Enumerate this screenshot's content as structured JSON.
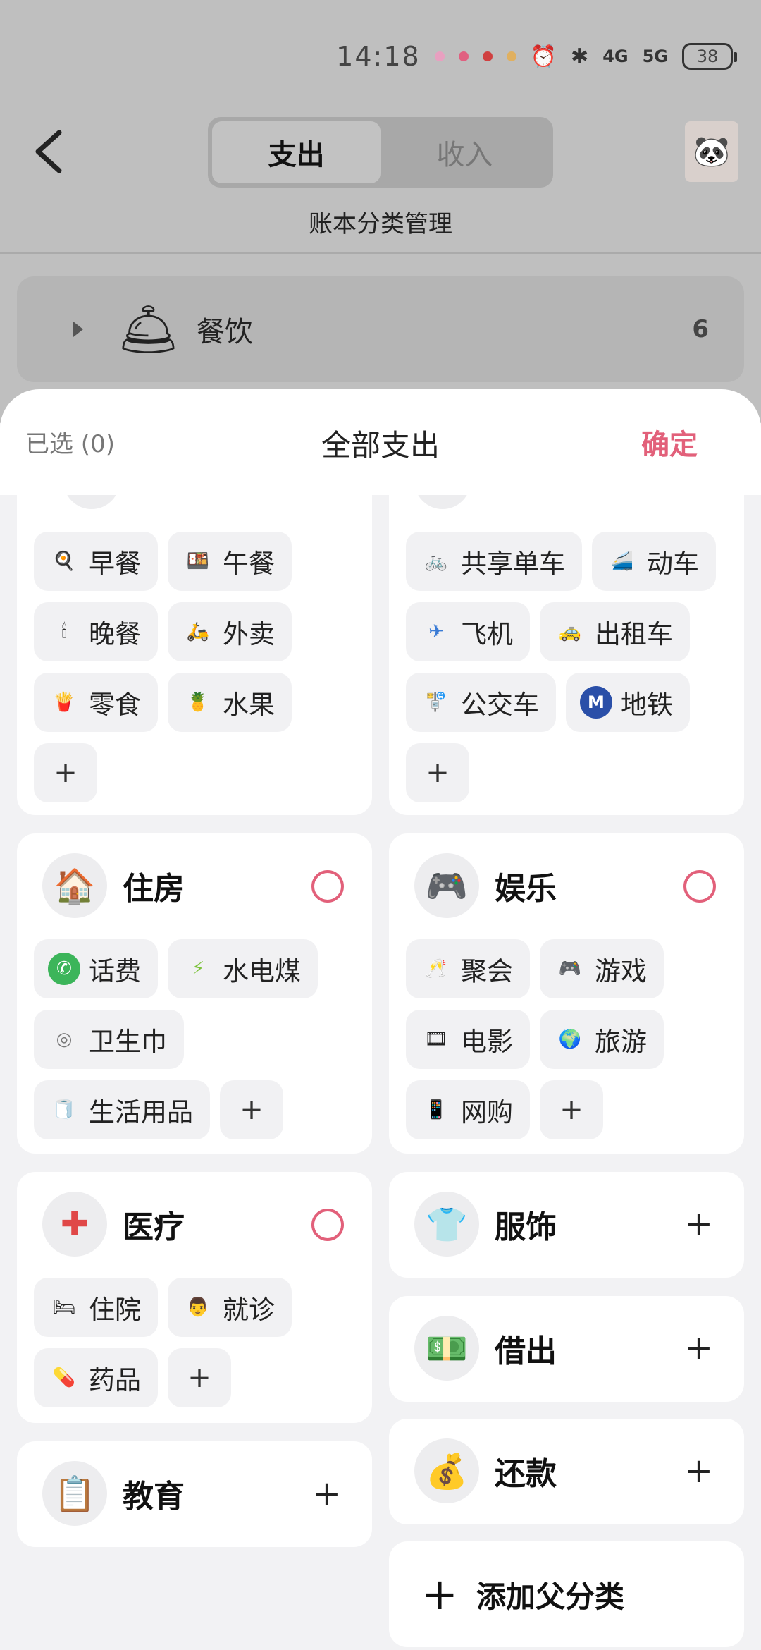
{
  "status_bar": {
    "time": "14:18",
    "network1": "4G",
    "network2": "5G",
    "battery": "38"
  },
  "header": {
    "tabs": [
      "支出",
      "收入"
    ],
    "active_tab": "支出",
    "subtitle": "账本分类管理"
  },
  "background_row": {
    "name": "餐饮",
    "count": "6"
  },
  "sheet": {
    "selected_label": "已选 (0)",
    "title": "全部支出",
    "confirm": "确定"
  },
  "top_left_card": {
    "chips": [
      {
        "label": "早餐",
        "icon": "breakfast-icon",
        "glyph": "🍳"
      },
      {
        "label": "午餐",
        "icon": "lunch-icon",
        "glyph": "🍱"
      },
      {
        "label": "晚餐",
        "icon": "dinner-icon",
        "glyph": "🕯"
      },
      {
        "label": "外卖",
        "icon": "delivery-icon",
        "glyph": "🛵"
      },
      {
        "label": "零食",
        "icon": "snack-icon",
        "glyph": "🍟"
      },
      {
        "label": "水果",
        "icon": "fruit-icon",
        "glyph": "🍍"
      }
    ]
  },
  "top_right_card": {
    "chips": [
      {
        "label": "共享单车",
        "icon": "bike-icon",
        "glyph": "🚲"
      },
      {
        "label": "动车",
        "icon": "train-icon",
        "glyph": "🚄"
      },
      {
        "label": "飞机",
        "icon": "plane-icon",
        "glyph": "✈"
      },
      {
        "label": "出租车",
        "icon": "taxi-icon",
        "glyph": "🚕"
      },
      {
        "label": "公交车",
        "icon": "bus-stop-icon",
        "glyph": "🚏"
      },
      {
        "label": "地铁",
        "icon": "metro-icon",
        "glyph": "Ⓜ"
      }
    ]
  },
  "housing": {
    "title": "住房",
    "icon": "house-icon",
    "glyph": "🏠",
    "chips": [
      {
        "label": "话费",
        "icon": "phone-icon",
        "glyph": "📞"
      },
      {
        "label": "水电煤",
        "icon": "utilities-icon",
        "glyph": "⚡"
      },
      {
        "label": "卫生巾",
        "icon": "pad-icon",
        "glyph": "◎"
      },
      {
        "label": "生活用品",
        "icon": "tissue-icon",
        "glyph": "🧻"
      }
    ]
  },
  "entertainment": {
    "title": "娱乐",
    "icon": "gamepad-icon",
    "glyph": "🎮",
    "chips": [
      {
        "label": "聚会",
        "icon": "cheers-icon",
        "glyph": "🥂"
      },
      {
        "label": "游戏",
        "icon": "controller-icon",
        "glyph": "🎮"
      },
      {
        "label": "电影",
        "icon": "film-icon",
        "glyph": "🎞"
      },
      {
        "label": "旅游",
        "icon": "travel-icon",
        "glyph": "🌍"
      },
      {
        "label": "网购",
        "icon": "shopping-icon",
        "glyph": "📱"
      }
    ]
  },
  "medical": {
    "title": "医疗",
    "icon": "first-aid-icon",
    "glyph": "✚",
    "chips": [
      {
        "label": "住院",
        "icon": "hospital-bed-icon",
        "glyph": "🛏"
      },
      {
        "label": "就诊",
        "icon": "doctor-icon",
        "glyph": "👨"
      },
      {
        "label": "药品",
        "icon": "pills-icon",
        "glyph": "💊"
      }
    ]
  },
  "clothing": {
    "title": "服饰",
    "icon": "shirt-icon",
    "glyph": "👕"
  },
  "lending": {
    "title": "借出",
    "icon": "money-hand-icon",
    "glyph": "💵"
  },
  "education": {
    "title": "教育",
    "icon": "blackboard-icon",
    "glyph": "📋"
  },
  "repayment": {
    "title": "还款",
    "icon": "money-bag-icon",
    "glyph": "💰"
  },
  "add_parent": {
    "label": "添加父分类"
  },
  "colors": {
    "accent": "#e2607a",
    "chip_bg": "#f1f1f3",
    "card_bg": "#ffffff",
    "page_bg": "#f2f2f4"
  }
}
